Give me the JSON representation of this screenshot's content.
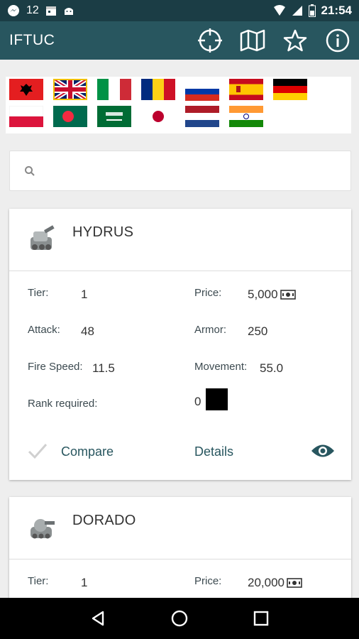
{
  "status_bar": {
    "notification_count": "12",
    "time": "21:54"
  },
  "app_bar": {
    "title": "IFTUC",
    "actions": [
      "crosshair-icon",
      "map-icon",
      "star-icon",
      "info-icon"
    ]
  },
  "languages": [
    {
      "name": "flag-albania"
    },
    {
      "name": "flag-uk"
    },
    {
      "name": "flag-italy"
    },
    {
      "name": "flag-romania"
    },
    {
      "name": "flag-russia"
    },
    {
      "name": "flag-spain"
    },
    {
      "name": "flag-germany"
    },
    {
      "name": "flag-poland"
    },
    {
      "name": "flag-bangladesh"
    },
    {
      "name": "flag-saudi-arabia"
    },
    {
      "name": "flag-japan"
    },
    {
      "name": "flag-netherlands"
    },
    {
      "name": "flag-india"
    }
  ],
  "search": {
    "placeholder": "",
    "value": ""
  },
  "labels": {
    "tier": "Tier:",
    "price": "Price:",
    "attack": "Attack:",
    "armor": "Armor:",
    "fire_speed": "Fire Speed:",
    "movement": "Movement:",
    "rank_required": "Rank required:",
    "compare": "Compare",
    "details": "Details"
  },
  "units": [
    {
      "name": "HYDRUS",
      "tier": "1",
      "price": "5,000",
      "attack": "48",
      "armor": "250",
      "fire_speed": "11.5",
      "movement": "55.0",
      "rank_required": "0"
    },
    {
      "name": "DORADO",
      "tier": "1",
      "price": "20,000"
    }
  ],
  "colors": {
    "status_bar": "#1b3d45",
    "app_bar": "#28565f",
    "accent": "#28565f"
  }
}
